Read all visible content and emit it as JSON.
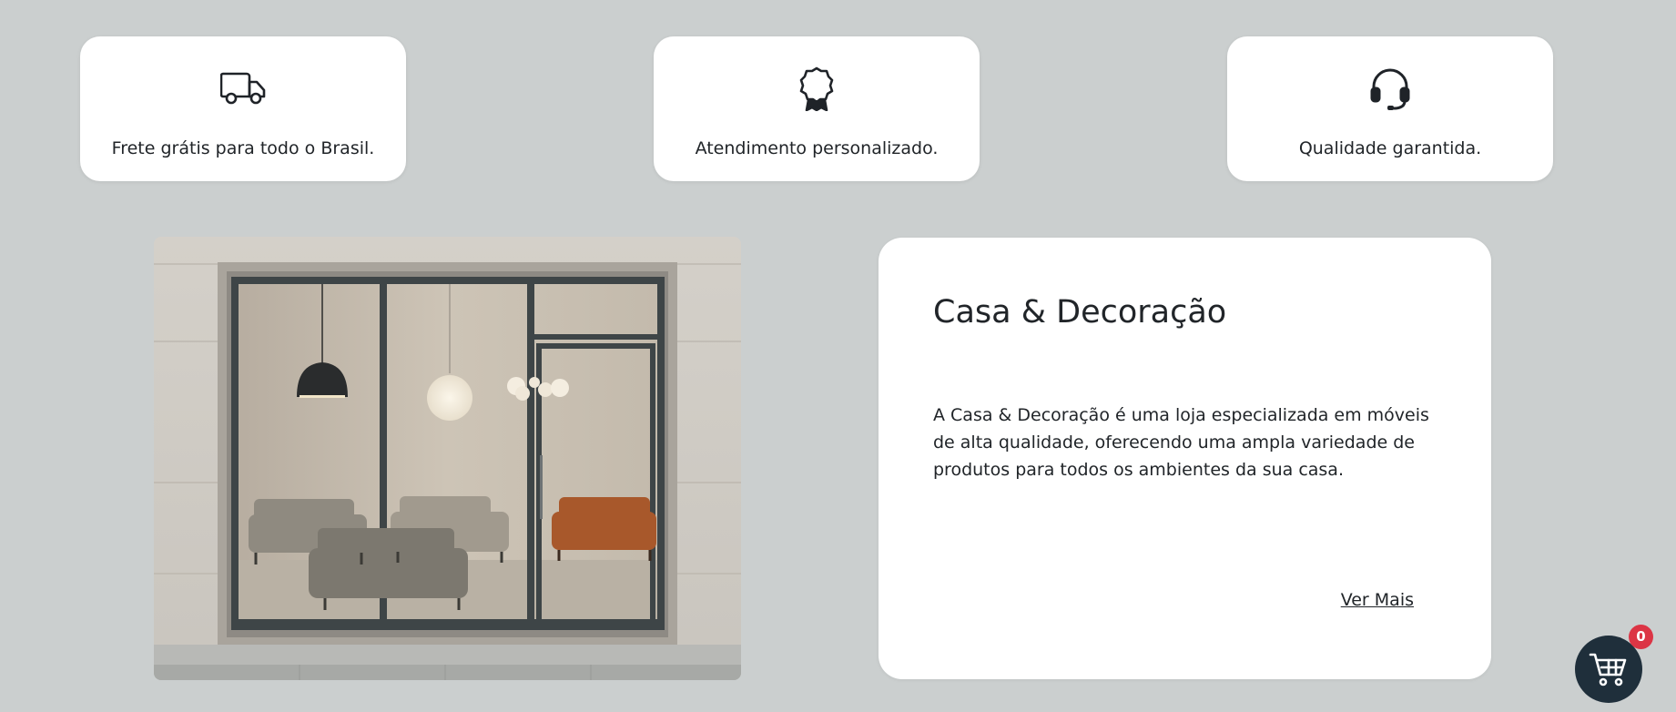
{
  "features": [
    {
      "icon": "truck-icon",
      "text": "Frete grátis para todo o Brasil."
    },
    {
      "icon": "award-icon",
      "text": "Atendimento personalizado."
    },
    {
      "icon": "headset-icon",
      "text": "Qualidade garantida."
    }
  ],
  "about": {
    "title": "Casa & Decoração",
    "description": "A Casa & Decoração é uma loja especializada em móveis de alta qualidade, oferecendo uma ampla variedade de produtos para todos os ambientes da sua casa.",
    "link_label": "Ver Mais"
  },
  "cart": {
    "icon": "cart-icon",
    "count": "0"
  },
  "colors": {
    "background": "#cbcfcf",
    "card": "#ffffff",
    "cart_button": "#1f2f3b",
    "badge": "#dc3545",
    "text": "#212529"
  }
}
